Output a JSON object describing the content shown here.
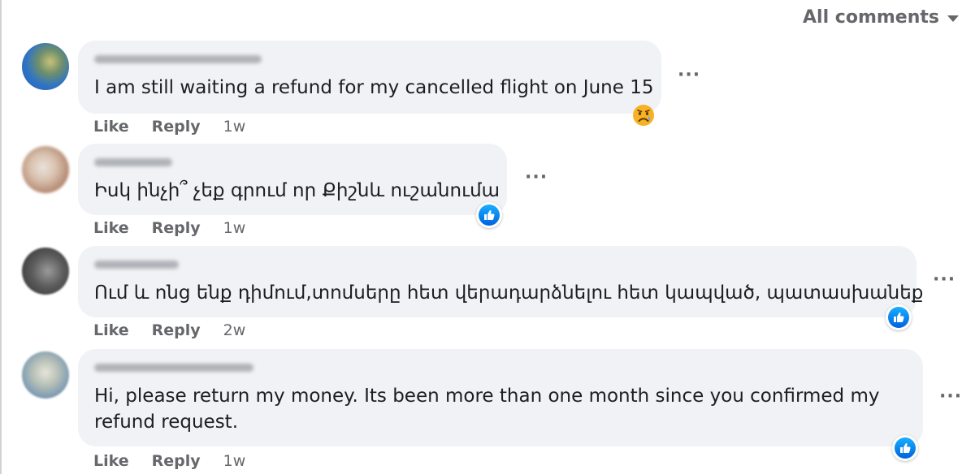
{
  "header": {
    "sort_label": "All comments"
  },
  "comments": [
    {
      "text": "I am still waiting a refund for my cancelled flight on June 15",
      "like_label": "Like",
      "reply_label": "Reply",
      "time": "1w",
      "reaction": "sad"
    },
    {
      "text": "Իսկ ինչի՞ չեք գրում որ Քիշնև ուշանումա",
      "like_label": "Like",
      "reply_label": "Reply",
      "time": "1w",
      "reaction": "like"
    },
    {
      "text": "Ում և ոնց ենք դիմում,տոմսերը հետ վերադարձնելու հետ կապված, պատասխանեք",
      "like_label": "Like",
      "reply_label": "Reply",
      "time": "2w",
      "reaction": "like"
    },
    {
      "text": "Hi, please return my money. Its been more than one month since you confirmed my refund request.",
      "like_label": "Like",
      "reply_label": "Reply",
      "time": "1w",
      "reaction": "like"
    }
  ],
  "icons": {
    "reaction_like": "thumbs-up-icon",
    "reaction_sad": "sad-face-icon",
    "more": "more-options-icon",
    "sort": "chevron-down-icon"
  },
  "colors": {
    "bubble": "#f0f2f5",
    "meta_text": "#65676b",
    "like_blue": "#0866ff",
    "sad_yellow": "#f7b125"
  }
}
